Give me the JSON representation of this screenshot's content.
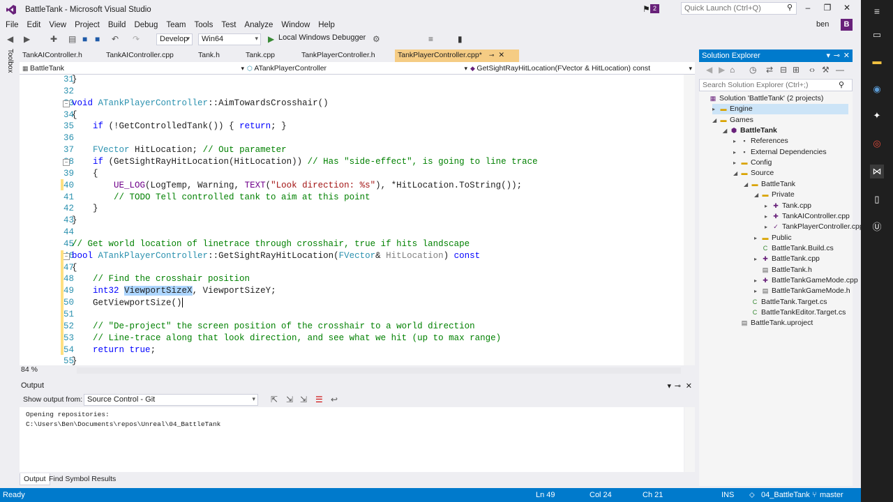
{
  "window": {
    "title": "BattleTank - Microsoft Visual Studio",
    "notifications_count": "2",
    "quick_launch_placeholder": "Quick Launch (Ctrl+Q)",
    "user_name": "ben",
    "user_initial": "B"
  },
  "menu": [
    "File",
    "Edit",
    "View",
    "Project",
    "Build",
    "Debug",
    "Team",
    "Tools",
    "Test",
    "Analyze",
    "Window",
    "Help"
  ],
  "toolbar": {
    "configuration": "Develop",
    "platform": "Win64",
    "debugger_label": "Local Windows Debugger"
  },
  "toolbox_label": "Toolbox",
  "tabs": [
    "TankAIController.h",
    "TankAIController.cpp",
    "Tank.h",
    "Tank.cpp",
    "TankPlayerController.h",
    "TankPlayerController.cpp*"
  ],
  "nav": {
    "project": "BattleTank",
    "class": "ATankPlayerController",
    "member": "GetSightRayHitLocation(FVector & HitLocation) const"
  },
  "editor": {
    "zoom": "84 %",
    "line_numbers": [
      "31",
      "32",
      "33",
      "34",
      "35",
      "36",
      "37",
      "38",
      "39",
      "40",
      "41",
      "42",
      "43",
      "44",
      "45",
      "46",
      "47",
      "48",
      "49",
      "50",
      "51",
      "52",
      "53",
      "54",
      "55"
    ]
  },
  "output": {
    "title": "Output",
    "show_output_from_label": "Show output from:",
    "source": "Source Control - Git",
    "lines": [
      "Opening repositories:",
      "C:\\Users\\Ben\\Documents\\repos\\Unreal\\04_BattleTank"
    ]
  },
  "bottom_tabs": [
    "Output",
    "Find Symbol Results"
  ],
  "solution_explorer": {
    "title": "Solution Explorer",
    "search_placeholder": "Search Solution Explorer (Ctrl+;)",
    "items": [
      {
        "label": "Solution 'BattleTank' (2 projects)"
      },
      {
        "label": "Engine"
      },
      {
        "label": "Games"
      },
      {
        "label": "BattleTank"
      },
      {
        "label": "References"
      },
      {
        "label": "External Dependencies"
      },
      {
        "label": "Config"
      },
      {
        "label": "Source"
      },
      {
        "label": "BattleTank"
      },
      {
        "label": "Private"
      },
      {
        "label": "Tank.cpp"
      },
      {
        "label": "TankAIController.cpp"
      },
      {
        "label": "TankPlayerController.cpp"
      },
      {
        "label": "Public"
      },
      {
        "label": "BattleTank.Build.cs"
      },
      {
        "label": "BattleTank.cpp"
      },
      {
        "label": "BattleTank.h"
      },
      {
        "label": "BattleTankGameMode.cpp"
      },
      {
        "label": "BattleTankGameMode.h"
      },
      {
        "label": "BattleTank.Target.cs"
      },
      {
        "label": "BattleTankEditor.Target.cs"
      },
      {
        "label": "BattleTank.uproject"
      }
    ]
  },
  "status": {
    "ready": "Ready",
    "line": "Ln 49",
    "col": "Col 24",
    "ch": "Ch 21",
    "ins": "INS",
    "repo": "04_BattleTank",
    "branch": "master"
  },
  "colors": {
    "accent": "#007acc",
    "vs_purple": "#68217a",
    "active_tab": "#f5cc84"
  }
}
